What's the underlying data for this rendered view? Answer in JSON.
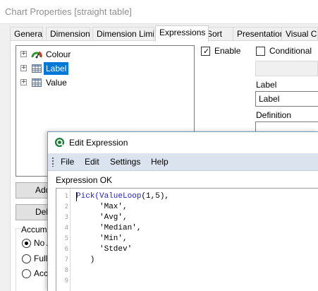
{
  "window": {
    "title": "Chart Properties [straight table]"
  },
  "tabs": [
    {
      "label": "General"
    },
    {
      "label": "Dimensions"
    },
    {
      "label": "Dimension Limits"
    },
    {
      "label": "Expressions"
    },
    {
      "label": "Sort"
    },
    {
      "label": "Presentation"
    },
    {
      "label": "Visual Cues"
    }
  ],
  "active_tab": "Expressions",
  "tree": {
    "items": [
      {
        "label": "Colour",
        "icon": "gauge-icon"
      },
      {
        "label": "Label",
        "icon": "table-icon",
        "selected": true
      },
      {
        "label": "Value",
        "icon": "table-icon"
      }
    ]
  },
  "options": {
    "enable_label": "Enable",
    "enable_checked": true,
    "conditional_label": "Conditional",
    "conditional_checked": false,
    "label_caption": "Label",
    "label_value": "Label",
    "definition_caption": "Definition"
  },
  "buttons": {
    "add": "Add...",
    "delete": "Delete"
  },
  "accumulation": {
    "title": "Accumulation",
    "options": [
      {
        "label": "No Accumulation",
        "selected": true
      },
      {
        "label": "Full Accumulation",
        "selected": false
      },
      {
        "label": "Accumulate",
        "selected": false
      }
    ]
  },
  "dialog": {
    "title": "Edit Expression",
    "menu": [
      {
        "label": "File"
      },
      {
        "label": "Edit"
      },
      {
        "label": "Settings"
      },
      {
        "label": "Help"
      }
    ],
    "status": "Expression OK",
    "line_numbers": [
      "1",
      "2",
      "3",
      "4",
      "5",
      "6",
      "7",
      "8",
      "9"
    ],
    "code": [
      {
        "fn": "Pick(ValueLoop",
        "rest": "(1,5),"
      },
      {
        "fn": "",
        "rest": "     'Max',"
      },
      {
        "fn": "",
        "rest": "     'Avg',"
      },
      {
        "fn": "",
        "rest": "     'Median',"
      },
      {
        "fn": "",
        "rest": "     'Min',"
      },
      {
        "fn": "",
        "rest": "     'Stdev'"
      },
      {
        "fn": "",
        "rest": "   )"
      },
      {
        "fn": "",
        "rest": ""
      },
      {
        "fn": "",
        "rest": ""
      }
    ]
  },
  "colors": {
    "selection": "#0078d7",
    "menubar": "#dbe3ee",
    "function_keyword": "#2222c8"
  }
}
